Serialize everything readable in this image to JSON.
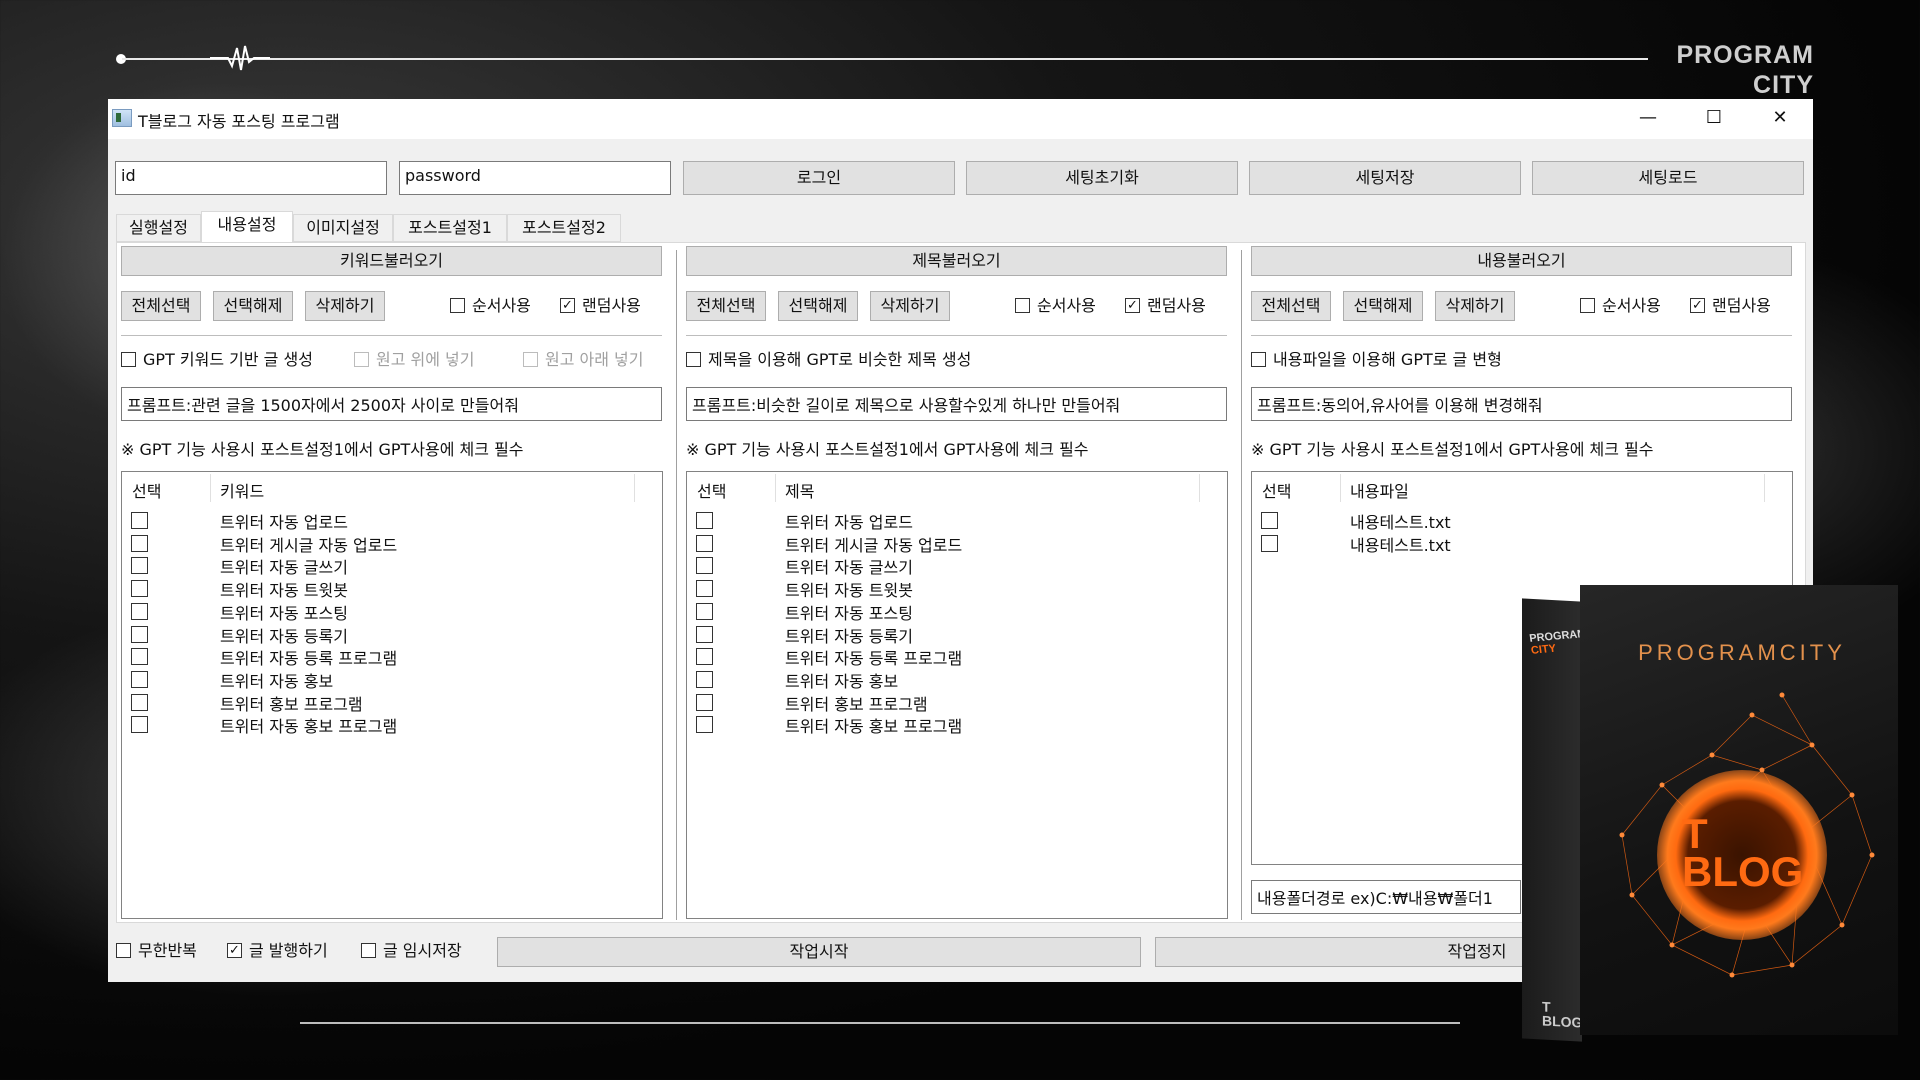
{
  "brand": {
    "line1": "PROGRAM",
    "line2": "CITY"
  },
  "window": {
    "title": "T블로그 자동 포스팅 프로그램",
    "controls": {
      "minimize": "—",
      "maximize": "☐",
      "close": "✕"
    }
  },
  "login": {
    "id_value": "id",
    "password_value": "password",
    "login_label": "로그인",
    "reset_label": "세팅초기화",
    "save_label": "세팅저장",
    "load_label": "세팅로드"
  },
  "tabs": [
    "실행설정",
    "내용설정",
    "이미지설정",
    "포스트설정1",
    "포스트설정2"
  ],
  "columns": [
    {
      "load_label": "키워드불러오기",
      "select_all": "전체선택",
      "deselect": "선택해제",
      "delete": "삭제하기",
      "seq_label": "순서사용",
      "random_label": "랜덤사용",
      "gpt_label": "GPT 키워드 기반 글 생성",
      "opt_above": "원고 위에 넣기",
      "opt_below": "원고 아래 넣기",
      "prompt": "프롬프트:관련 글을 1500자에서 2500자 사이로 만들어줘",
      "hint": "※ GPT 기능 사용시 포스트설정1에서 GPT사용에 체크 필수",
      "header_select": "선택",
      "header_name": "키워드",
      "items": [
        "트위터 자동 업로드",
        "트위터 게시글 자동 업로드",
        "트위터 자동 글쓰기",
        "트위터 자동 트윗봇",
        "트위터 자동 포스팅",
        "트위터 자동 등록기",
        "트위터 자동 등록 프로그램",
        "트위터 자동 홍보",
        "트위터 홍보 프로그램",
        "트위터 자동 홍보 프로그램"
      ]
    },
    {
      "load_label": "제목불러오기",
      "select_all": "전체선택",
      "deselect": "선택해제",
      "delete": "삭제하기",
      "seq_label": "순서사용",
      "random_label": "랜덤사용",
      "gpt_label": "제목을 이용해 GPT로 비슷한 제목 생성",
      "prompt": "프롬프트:비슷한 길이로 제목으로 사용할수있게 하나만 만들어줘",
      "hint": "※ GPT 기능 사용시 포스트설정1에서 GPT사용에 체크 필수",
      "header_select": "선택",
      "header_name": "제목",
      "items": [
        "트위터 자동 업로드",
        "트위터 게시글 자동 업로드",
        "트위터 자동 글쓰기",
        "트위터 자동 트윗봇",
        "트위터 자동 포스팅",
        "트위터 자동 등록기",
        "트위터 자동 등록 프로그램",
        "트위터 자동 홍보",
        "트위터 홍보 프로그램",
        "트위터 자동 홍보 프로그램"
      ]
    },
    {
      "load_label": "내용불러오기",
      "select_all": "전체선택",
      "deselect": "선택해제",
      "delete": "삭제하기",
      "seq_label": "순서사용",
      "random_label": "랜덤사용",
      "gpt_label": "내용파일을 이용해 GPT로 글 변형",
      "prompt": "프롬프트:동의어,유사어를 이용해 변경해줘",
      "hint": "※ GPT 기능 사용시 포스트설정1에서 GPT사용에 체크 필수",
      "header_select": "선택",
      "header_name": "내용파일",
      "items": [
        "내용테스트.txt",
        "내용테스트.txt"
      ],
      "folder_path": "내용폴더경로 ex)C:₩내용₩폴더1"
    }
  ],
  "footer": {
    "loop_label": "무한반복",
    "publish_label": "글 발행하기",
    "draft_label": "글 임시저장",
    "start_label": "작업시작",
    "stop_label": "작업정지"
  },
  "product_box": {
    "front_brand": "PROGRAMCITY",
    "logo_line1": "T",
    "logo_line2": "BLOG",
    "side_brand_1": "PROGRAM",
    "side_brand_2": "CITY",
    "side_logo_1": "T",
    "side_logo_2": "BLOG"
  },
  "colors": {
    "accent_orange": "#ff6a12",
    "window_bg": "#f0f0f0"
  }
}
